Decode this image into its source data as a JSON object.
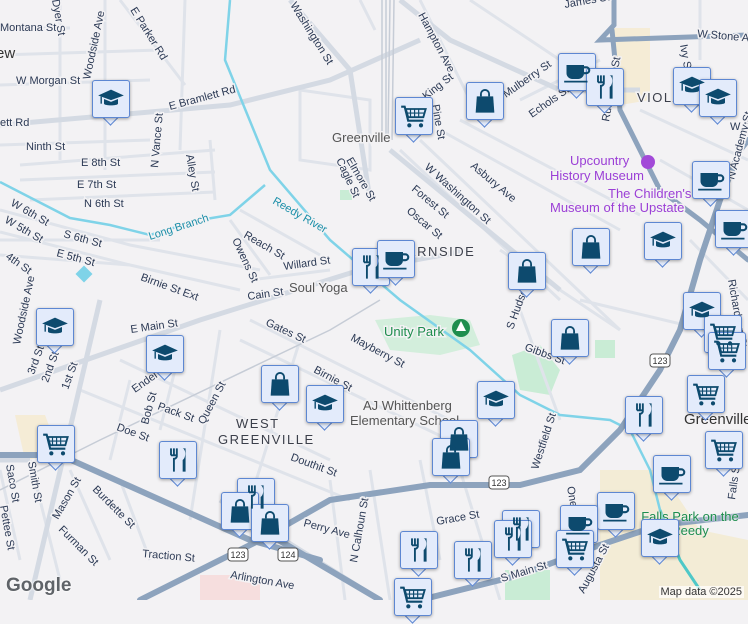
{
  "map": {
    "streets": [
      "Montana St",
      "Dyer St",
      "Woodside Ave",
      "E Parker Rd",
      "Washington St",
      "W Morgan St",
      "E Bramlett Rd",
      "ett Rd",
      "Ninth St",
      "N Vance St",
      "E 8th St",
      "E 7th St",
      "N 6th St",
      "Alley St",
      "W 6th St",
      "W 5th St",
      "S 6th St",
      "E 5th St",
      "4th St",
      "Woodside Ave",
      "Birnie St Ext",
      "Reach St",
      "Owens St",
      "Willard St",
      "Cain St",
      "Elmore St",
      "Cagle St",
      "Hampton Ave",
      "King St",
      "Pine St",
      "Mulberry St",
      "Echols St",
      "Rutherford St",
      "Ivy St",
      "W Stone Ave",
      "Asbury Ave",
      "W Washington St",
      "Forest St",
      "Oscar St",
      "S Hudson St",
      "Gibbs St",
      "Mayberry St",
      "Gates St",
      "Birnie St",
      "E Main St",
      "3rd St",
      "2nd St",
      "1st St",
      "Endel St",
      "Bob St",
      "Pack St",
      "Queen St",
      "Doe St",
      "Douthit St",
      "Westfield St",
      "Smith St",
      "Saco St",
      "Mason St",
      "Burdette St",
      "Pettee St",
      "Furman St",
      "Traction St",
      "Perry Ave",
      "Arlington Ave",
      "N Calhoun St",
      "Grace St",
      "S Main St",
      "Augusta St",
      "Falls St",
      "Oneal St",
      "Richardson St",
      "W Pe",
      "James St",
      "N Academy St"
    ],
    "neighborhoods": [
      "WEST\nGREENVILLE",
      "ERNSIDE",
      "VIOLA"
    ],
    "places": [
      "Greenville",
      "Soul Yoga",
      "AJ Whittenberg Elementary School",
      "Greenville",
      "ew"
    ],
    "museums": [
      "Upcountry History Museum",
      "The Children's Museum of the Upstate"
    ],
    "parks": [
      "Unity Park",
      "Falls Park on the Reedy"
    ],
    "waterways": [
      "Reedy River",
      "Long Branch"
    ],
    "route_shields": [
      "123",
      "124",
      "123",
      "123"
    ],
    "markers": [
      {
        "type": "school-icon"
      },
      {
        "type": "shopping-bag-icon"
      },
      {
        "type": "cart-icon"
      },
      {
        "type": "coffee-icon"
      },
      {
        "type": "restaurant-icon"
      },
      {
        "type": "school-icon"
      },
      {
        "type": "school-icon"
      },
      {
        "type": "coffee-icon"
      },
      {
        "type": "school-icon"
      },
      {
        "type": "shopping-bag-icon"
      },
      {
        "type": "shopping-bag-icon"
      },
      {
        "type": "coffee-icon"
      },
      {
        "type": "restaurant-icon"
      },
      {
        "type": "coffee-icon"
      },
      {
        "type": "school-icon"
      },
      {
        "type": "school-icon"
      },
      {
        "type": "shopping-bag-icon"
      },
      {
        "type": "school-icon"
      },
      {
        "type": "shopping-bag-icon"
      },
      {
        "type": "school-icon"
      },
      {
        "type": "cart-icon"
      },
      {
        "type": "cart-icon"
      },
      {
        "type": "cart-icon"
      },
      {
        "type": "school-icon"
      },
      {
        "type": "restaurant-icon"
      },
      {
        "type": "cart-icon"
      },
      {
        "type": "shopping-bag-icon"
      },
      {
        "type": "shopping-bag-icon"
      },
      {
        "type": "cart-icon"
      },
      {
        "type": "restaurant-icon"
      },
      {
        "type": "coffee-icon"
      },
      {
        "type": "restaurant-icon"
      },
      {
        "type": "shopping-bag-icon"
      },
      {
        "type": "shopping-bag-icon"
      },
      {
        "type": "coffee-icon"
      },
      {
        "type": "coffee-icon"
      },
      {
        "type": "restaurant-icon"
      },
      {
        "type": "restaurant-icon"
      },
      {
        "type": "school-icon"
      },
      {
        "type": "restaurant-icon"
      },
      {
        "type": "restaurant-icon"
      },
      {
        "type": "cart-icon"
      },
      {
        "type": "cart-icon"
      }
    ],
    "colors": {
      "marker_icon": "#0d4a6e",
      "marker_bg": "#e3ebfb",
      "highway": "#8da3bd",
      "river": "#7fd3e8",
      "park": "#c9ecd5"
    }
  },
  "attribution": "Map data ©2025",
  "logo": "Google"
}
